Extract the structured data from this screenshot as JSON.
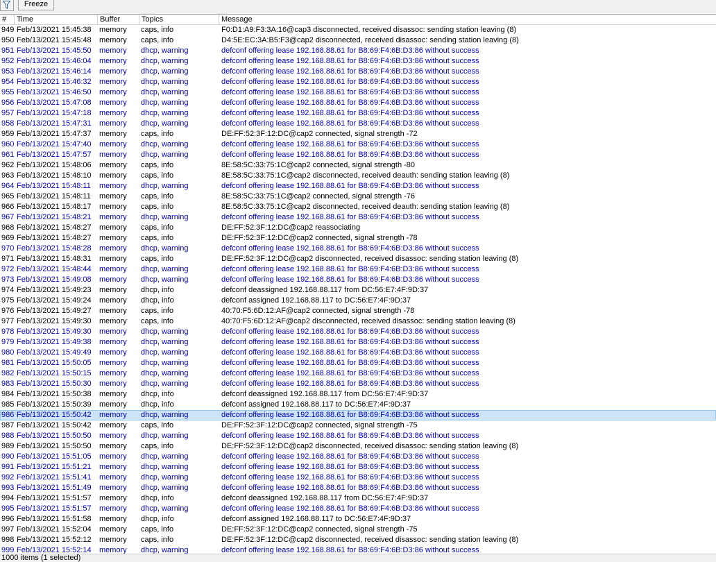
{
  "toolbar": {
    "filter_icon": "filter-icon",
    "freeze_label": "Freeze"
  },
  "columns": [
    "#",
    "Time",
    "Buffer",
    "Topics",
    "Message"
  ],
  "rows": [
    {
      "n": "949",
      "t": "Feb/13/2021 15:45:38",
      "b": "memory",
      "tp": "caps, info",
      "m": "F0:D1:A9:F3:3A:16@cap3 disconnected, received disassoc: sending station leaving (8)",
      "w": false
    },
    {
      "n": "950",
      "t": "Feb/13/2021 15:45:48",
      "b": "memory",
      "tp": "caps, info",
      "m": "D4:5E:EC:3A:B5:F3@cap2 disconnected, received disassoc: sending station leaving (8)",
      "w": false
    },
    {
      "n": "951",
      "t": "Feb/13/2021 15:45:50",
      "b": "memory",
      "tp": "dhcp, warning",
      "m": "defconf offering lease 192.168.88.61 for B8:69:F4:6B:D3:86 without success",
      "w": true
    },
    {
      "n": "952",
      "t": "Feb/13/2021 15:46:04",
      "b": "memory",
      "tp": "dhcp, warning",
      "m": "defconf offering lease 192.168.88.61 for B8:69:F4:6B:D3:86 without success",
      "w": true
    },
    {
      "n": "953",
      "t": "Feb/13/2021 15:46:14",
      "b": "memory",
      "tp": "dhcp, warning",
      "m": "defconf offering lease 192.168.88.61 for B8:69:F4:6B:D3:86 without success",
      "w": true
    },
    {
      "n": "954",
      "t": "Feb/13/2021 15:46:32",
      "b": "memory",
      "tp": "dhcp, warning",
      "m": "defconf offering lease 192.168.88.61 for B8:69:F4:6B:D3:86 without success",
      "w": true
    },
    {
      "n": "955",
      "t": "Feb/13/2021 15:46:50",
      "b": "memory",
      "tp": "dhcp, warning",
      "m": "defconf offering lease 192.168.88.61 for B8:69:F4:6B:D3:86 without success",
      "w": true
    },
    {
      "n": "956",
      "t": "Feb/13/2021 15:47:08",
      "b": "memory",
      "tp": "dhcp, warning",
      "m": "defconf offering lease 192.168.88.61 for B8:69:F4:6B:D3:86 without success",
      "w": true
    },
    {
      "n": "957",
      "t": "Feb/13/2021 15:47:18",
      "b": "memory",
      "tp": "dhcp, warning",
      "m": "defconf offering lease 192.168.88.61 for B8:69:F4:6B:D3:86 without success",
      "w": true
    },
    {
      "n": "958",
      "t": "Feb/13/2021 15:47:31",
      "b": "memory",
      "tp": "dhcp, warning",
      "m": "defconf offering lease 192.168.88.61 for B8:69:F4:6B:D3:86 without success",
      "w": true
    },
    {
      "n": "959",
      "t": "Feb/13/2021 15:47:37",
      "b": "memory",
      "tp": "caps, info",
      "m": "DE:FF:52:3F:12:DC@cap2 connected, signal strength -72",
      "w": false
    },
    {
      "n": "960",
      "t": "Feb/13/2021 15:47:40",
      "b": "memory",
      "tp": "dhcp, warning",
      "m": "defconf offering lease 192.168.88.61 for B8:69:F4:6B:D3:86 without success",
      "w": true
    },
    {
      "n": "961",
      "t": "Feb/13/2021 15:47:57",
      "b": "memory",
      "tp": "dhcp, warning",
      "m": "defconf offering lease 192.168.88.61 for B8:69:F4:6B:D3:86 without success",
      "w": true
    },
    {
      "n": "962",
      "t": "Feb/13/2021 15:48:06",
      "b": "memory",
      "tp": "caps, info",
      "m": "8E:58:5C:33:75:1C@cap2 connected, signal strength -80",
      "w": false
    },
    {
      "n": "963",
      "t": "Feb/13/2021 15:48:10",
      "b": "memory",
      "tp": "caps, info",
      "m": "8E:58:5C:33:75:1C@cap2 disconnected, received deauth: sending station leaving (8)",
      "w": false
    },
    {
      "n": "964",
      "t": "Feb/13/2021 15:48:11",
      "b": "memory",
      "tp": "dhcp, warning",
      "m": "defconf offering lease 192.168.88.61 for B8:69:F4:6B:D3:86 without success",
      "w": true
    },
    {
      "n": "965",
      "t": "Feb/13/2021 15:48:11",
      "b": "memory",
      "tp": "caps, info",
      "m": "8E:58:5C:33:75:1C@cap2 connected, signal strength -76",
      "w": false
    },
    {
      "n": "966",
      "t": "Feb/13/2021 15:48:17",
      "b": "memory",
      "tp": "caps, info",
      "m": "8E:58:5C:33:75:1C@cap2 disconnected, received deauth: sending station leaving (8)",
      "w": false
    },
    {
      "n": "967",
      "t": "Feb/13/2021 15:48:21",
      "b": "memory",
      "tp": "dhcp, warning",
      "m": "defconf offering lease 192.168.88.61 for B8:69:F4:6B:D3:86 without success",
      "w": true
    },
    {
      "n": "968",
      "t": "Feb/13/2021 15:48:27",
      "b": "memory",
      "tp": "caps, info",
      "m": "DE:FF:52:3F:12:DC@cap2 reassociating",
      "w": false
    },
    {
      "n": "969",
      "t": "Feb/13/2021 15:48:27",
      "b": "memory",
      "tp": "caps, info",
      "m": "DE:FF:52:3F:12:DC@cap2 connected, signal strength -78",
      "w": false
    },
    {
      "n": "970",
      "t": "Feb/13/2021 15:48:28",
      "b": "memory",
      "tp": "dhcp, warning",
      "m": "defconf offering lease 192.168.88.61 for B8:69:F4:6B:D3:86 without success",
      "w": true
    },
    {
      "n": "971",
      "t": "Feb/13/2021 15:48:31",
      "b": "memory",
      "tp": "caps, info",
      "m": "DE:FF:52:3F:12:DC@cap2 disconnected, received disassoc: sending station leaving (8)",
      "w": false
    },
    {
      "n": "972",
      "t": "Feb/13/2021 15:48:44",
      "b": "memory",
      "tp": "dhcp, warning",
      "m": "defconf offering lease 192.168.88.61 for B8:69:F4:6B:D3:86 without success",
      "w": true
    },
    {
      "n": "973",
      "t": "Feb/13/2021 15:49:08",
      "b": "memory",
      "tp": "dhcp, warning",
      "m": "defconf offering lease 192.168.88.61 for B8:69:F4:6B:D3:86 without success",
      "w": true
    },
    {
      "n": "974",
      "t": "Feb/13/2021 15:49:23",
      "b": "memory",
      "tp": "dhcp, info",
      "m": "defconf deassigned 192.168.88.117 from DC:56:E7:4F:9D:37",
      "w": false
    },
    {
      "n": "975",
      "t": "Feb/13/2021 15:49:24",
      "b": "memory",
      "tp": "dhcp, info",
      "m": "defconf assigned 192.168.88.117 to DC:56:E7:4F:9D:37",
      "w": false
    },
    {
      "n": "976",
      "t": "Feb/13/2021 15:49:27",
      "b": "memory",
      "tp": "caps, info",
      "m": "40:70:F5:6D:12:AF@cap2 connected, signal strength -78",
      "w": false
    },
    {
      "n": "977",
      "t": "Feb/13/2021 15:49:30",
      "b": "memory",
      "tp": "caps, info",
      "m": "40:70:F5:6D:12:AF@cap2 disconnected, received disassoc: sending station leaving (8)",
      "w": false
    },
    {
      "n": "978",
      "t": "Feb/13/2021 15:49:30",
      "b": "memory",
      "tp": "dhcp, warning",
      "m": "defconf offering lease 192.168.88.61 for B8:69:F4:6B:D3:86 without success",
      "w": true
    },
    {
      "n": "979",
      "t": "Feb/13/2021 15:49:38",
      "b": "memory",
      "tp": "dhcp, warning",
      "m": "defconf offering lease 192.168.88.61 for B8:69:F4:6B:D3:86 without success",
      "w": true
    },
    {
      "n": "980",
      "t": "Feb/13/2021 15:49:49",
      "b": "memory",
      "tp": "dhcp, warning",
      "m": "defconf offering lease 192.168.88.61 for B8:69:F4:6B:D3:86 without success",
      "w": true
    },
    {
      "n": "981",
      "t": "Feb/13/2021 15:50:05",
      "b": "memory",
      "tp": "dhcp, warning",
      "m": "defconf offering lease 192.168.88.61 for B8:69:F4:6B:D3:86 without success",
      "w": true
    },
    {
      "n": "982",
      "t": "Feb/13/2021 15:50:15",
      "b": "memory",
      "tp": "dhcp, warning",
      "m": "defconf offering lease 192.168.88.61 for B8:69:F4:6B:D3:86 without success",
      "w": true
    },
    {
      "n": "983",
      "t": "Feb/13/2021 15:50:30",
      "b": "memory",
      "tp": "dhcp, warning",
      "m": "defconf offering lease 192.168.88.61 for B8:69:F4:6B:D3:86 without success",
      "w": true
    },
    {
      "n": "984",
      "t": "Feb/13/2021 15:50:38",
      "b": "memory",
      "tp": "dhcp, info",
      "m": "defconf deassigned 192.168.88.117 from DC:56:E7:4F:9D:37",
      "w": false
    },
    {
      "n": "985",
      "t": "Feb/13/2021 15:50:39",
      "b": "memory",
      "tp": "dhcp, info",
      "m": "defconf assigned 192.168.88.117 to DC:56:E7:4F:9D:37",
      "w": false
    },
    {
      "n": "986",
      "t": "Feb/13/2021 15:50:42",
      "b": "memory",
      "tp": "dhcp, warning",
      "m": "defconf offering lease 192.168.88.61 for B8:69:F4:6B:D3:86 without success",
      "w": true,
      "selected": true
    },
    {
      "n": "987",
      "t": "Feb/13/2021 15:50:42",
      "b": "memory",
      "tp": "caps, info",
      "m": "DE:FF:52:3F:12:DC@cap2 connected, signal strength -75",
      "w": false
    },
    {
      "n": "988",
      "t": "Feb/13/2021 15:50:50",
      "b": "memory",
      "tp": "dhcp, warning",
      "m": "defconf offering lease 192.168.88.61 for B8:69:F4:6B:D3:86 without success",
      "w": true
    },
    {
      "n": "989",
      "t": "Feb/13/2021 15:50:50",
      "b": "memory",
      "tp": "caps, info",
      "m": "DE:FF:52:3F:12:DC@cap2 disconnected, received disassoc: sending station leaving (8)",
      "w": false
    },
    {
      "n": "990",
      "t": "Feb/13/2021 15:51:05",
      "b": "memory",
      "tp": "dhcp, warning",
      "m": "defconf offering lease 192.168.88.61 for B8:69:F4:6B:D3:86 without success",
      "w": true
    },
    {
      "n": "991",
      "t": "Feb/13/2021 15:51:21",
      "b": "memory",
      "tp": "dhcp, warning",
      "m": "defconf offering lease 192.168.88.61 for B8:69:F4:6B:D3:86 without success",
      "w": true
    },
    {
      "n": "992",
      "t": "Feb/13/2021 15:51:41",
      "b": "memory",
      "tp": "dhcp, warning",
      "m": "defconf offering lease 192.168.88.61 for B8:69:F4:6B:D3:86 without success",
      "w": true
    },
    {
      "n": "993",
      "t": "Feb/13/2021 15:51:49",
      "b": "memory",
      "tp": "dhcp, warning",
      "m": "defconf offering lease 192.168.88.61 for B8:69:F4:6B:D3:86 without success",
      "w": true
    },
    {
      "n": "994",
      "t": "Feb/13/2021 15:51:57",
      "b": "memory",
      "tp": "dhcp, info",
      "m": "defconf deassigned 192.168.88.117 from DC:56:E7:4F:9D:37",
      "w": false
    },
    {
      "n": "995",
      "t": "Feb/13/2021 15:51:57",
      "b": "memory",
      "tp": "dhcp, warning",
      "m": "defconf offering lease 192.168.88.61 for B8:69:F4:6B:D3:86 without success",
      "w": true
    },
    {
      "n": "996",
      "t": "Feb/13/2021 15:51:58",
      "b": "memory",
      "tp": "dhcp, info",
      "m": "defconf assigned 192.168.88.117 to DC:56:E7:4F:9D:37",
      "w": false
    },
    {
      "n": "997",
      "t": "Feb/13/2021 15:52:04",
      "b": "memory",
      "tp": "caps, info",
      "m": "DE:FF:52:3F:12:DC@cap2 connected, signal strength -75",
      "w": false
    },
    {
      "n": "998",
      "t": "Feb/13/2021 15:52:12",
      "b": "memory",
      "tp": "caps, info",
      "m": "DE:FF:52:3F:12:DC@cap2 disconnected, received disassoc: sending station leaving (8)",
      "w": false
    },
    {
      "n": "999",
      "t": "Feb/13/2021 15:52:14",
      "b": "memory",
      "tp": "dhcp, warning",
      "m": "defconf offering lease 192.168.88.61 for B8:69:F4:6B:D3:86 without success",
      "w": true
    }
  ],
  "status": {
    "text": "1000 items (1 selected)"
  },
  "colors": {
    "warning_text": "#0000c0",
    "selected_bg": "#cde4f7"
  }
}
